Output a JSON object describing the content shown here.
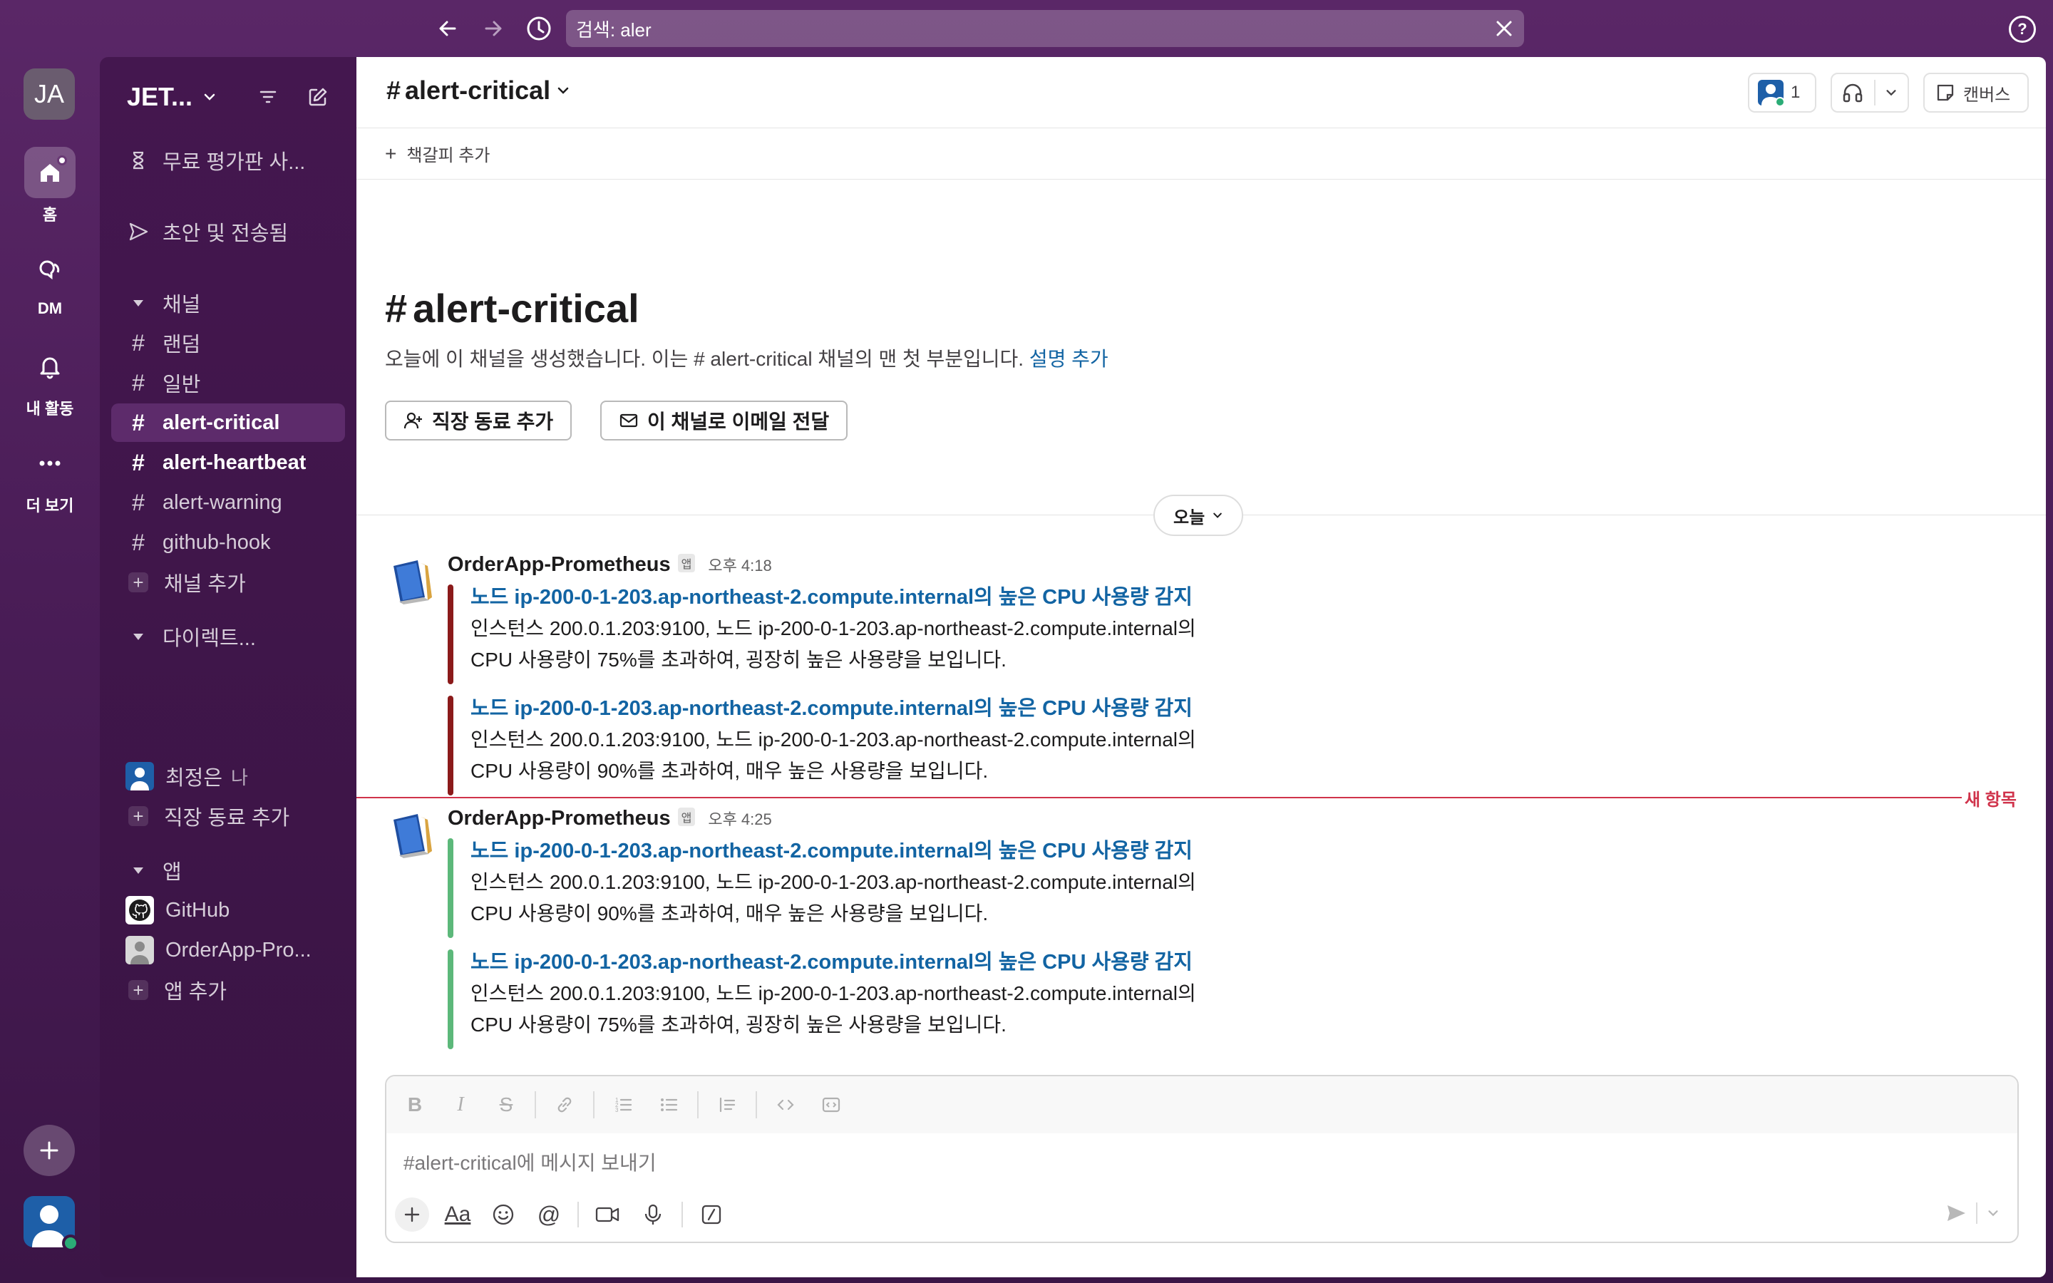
{
  "topbar": {
    "search_value": "검색: aler"
  },
  "rail": {
    "workspace_initials": "JA",
    "items": [
      {
        "label": "홈",
        "icon": "home-icon"
      },
      {
        "label": "DM",
        "icon": "dm-icon"
      },
      {
        "label": "내 활동",
        "icon": "bell-icon"
      },
      {
        "label": "더 보기",
        "icon": "more-icon"
      }
    ]
  },
  "sidebar": {
    "workspace_name": "JET...",
    "trial": "무료 평가판 사...",
    "drafts": "초안 및 전송됨",
    "channels_header": "채널",
    "channels": [
      "랜덤",
      "일반",
      "alert-critical",
      "alert-heartbeat",
      "alert-warning",
      "github-hook"
    ],
    "add_channel": "채널 추가",
    "dm_header": "다이렉트...",
    "dm_user": "최정은",
    "dm_user_sub": "나",
    "add_coworker": "직장 동료 추가",
    "apps_header": "앱",
    "apps": [
      "GitHub",
      "OrderApp-Pro..."
    ],
    "add_app": "앱 추가"
  },
  "channel": {
    "name": "alert-critical",
    "member_count": "1",
    "canvas_label": "캔버스",
    "bookmark_add": "책갈피 추가",
    "intro_title": "alert-critical",
    "intro_desc": "오늘에 이 채널을 생성했습니다. 이는 # alert-critical 채널의 맨 첫 부분입니다.",
    "intro_link": "설명 추가",
    "btn_add_coworker": "직장 동료 추가",
    "btn_email": "이 채널로 이메일 전달",
    "day_divider": "오늘",
    "new_items_label": "새 항목"
  },
  "messages": [
    {
      "sender": "OrderApp-Prometheus",
      "badge": "앱",
      "time": "오후 4:18",
      "attachments": [
        {
          "title": "노드 ip-200-0-1-203.ap-northeast-2.compute.internal의 높은 CPU 사용량 감지",
          "line1": "인스턴스 200.0.1.203:9100, 노드 ip-200-0-1-203.ap-northeast-2.compute.internal의",
          "line2": "CPU 사용량이 75%를 초과하여, 굉장히 높은 사용량을 보입니다.",
          "color": "#8b1a1a"
        },
        {
          "title": "노드 ip-200-0-1-203.ap-northeast-2.compute.internal의 높은 CPU 사용량 감지",
          "line1": "인스턴스 200.0.1.203:9100, 노드 ip-200-0-1-203.ap-northeast-2.compute.internal의",
          "line2": "CPU 사용량이 90%를 초과하여, 매우 높은 사용량을 보입니다.",
          "color": "#8b1a1a"
        }
      ]
    },
    {
      "sender": "OrderApp-Prometheus",
      "badge": "앱",
      "time": "오후 4:25",
      "attachments": [
        {
          "title": "노드 ip-200-0-1-203.ap-northeast-2.compute.internal의 높은 CPU 사용량 감지",
          "line1": "인스턴스 200.0.1.203:9100, 노드 ip-200-0-1-203.ap-northeast-2.compute.internal의",
          "line2": "CPU 사용량이 90%를 초과하여, 매우 높은 사용량을 보입니다.",
          "color": "#5cb87a"
        },
        {
          "title": "노드 ip-200-0-1-203.ap-northeast-2.compute.internal의 높은 CPU 사용량 감지",
          "line1": "인스턴스 200.0.1.203:9100, 노드 ip-200-0-1-203.ap-northeast-2.compute.internal의",
          "line2": "CPU 사용량이 75%를 초과하여, 굉장히 높은 사용량을 보입니다.",
          "color": "#5cb87a"
        }
      ]
    }
  ],
  "composer": {
    "placeholder": "#alert-critical에 메시지 보내기"
  },
  "colors": {
    "accent_link": "#1264a3",
    "new_divider": "#d0334b",
    "alert_firing": "#8b1a1a",
    "alert_ok": "#5cb87a",
    "sidebar_bg": "#3f0e40"
  }
}
